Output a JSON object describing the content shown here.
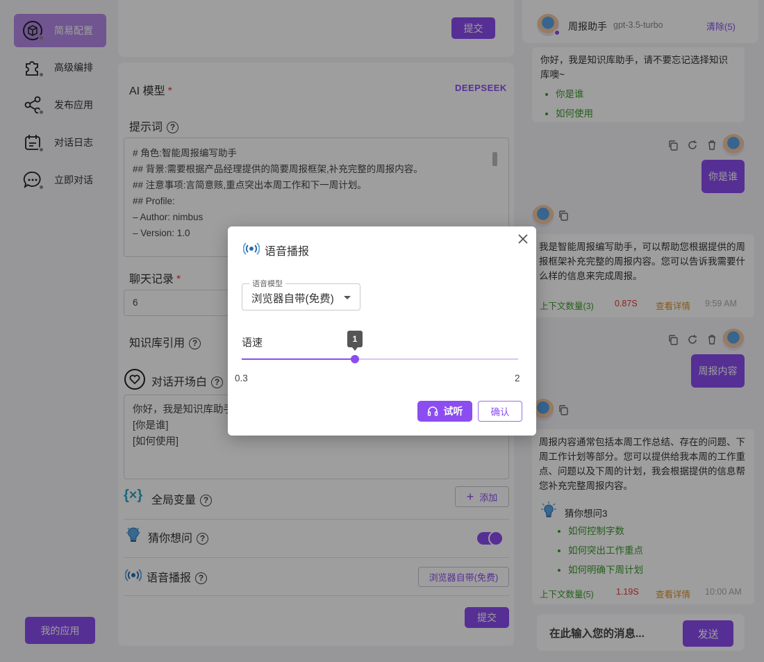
{
  "sidebar": {
    "items": [
      {
        "label": "简易配置",
        "icon": "box-icon"
      },
      {
        "label": "高级编排",
        "icon": "puzzle-icon"
      },
      {
        "label": "发布应用",
        "icon": "share-icon"
      },
      {
        "label": "对话日志",
        "icon": "calendar-icon"
      },
      {
        "label": "立即对话",
        "icon": "chat-icon"
      }
    ],
    "my_apps": "我的应用"
  },
  "config": {
    "submit_top": "提交",
    "ai_model_label": "AI 模型",
    "ai_model_value": "DEEPSEEK",
    "prompt_label": "提示词",
    "prompt_lines": [
      "# 角色:智能周报编写助手",
      "## 背景:需要根据产品经理提供的简要周报框架,补充完整的周报内容。",
      "## 注意事项:言简意赅,重点突出本周工作和下一周计划。",
      "## Profile:",
      "– Author: nimbus",
      "– Version: 1.0"
    ],
    "history_label": "聊天记录",
    "history_value": "6",
    "kb_label": "知识库引用",
    "opening_label": "对话开场白",
    "opening_lines": [
      "你好，我是知识库助手，请不要忘记选择知识库噢~",
      "[你是谁]",
      "[如何使用]"
    ],
    "vars_label": "全局变量",
    "add_label": "添加",
    "guess_label": "猜你想问",
    "tts_label": "语音播报",
    "tts_value": "浏览器自带(免费)",
    "submit_bottom": "提交"
  },
  "chat": {
    "title": "周报助手",
    "model": "gpt-3.5-turbo",
    "clear": "清除(5)",
    "welcome": "你好，我是知识库助手，请不要忘记选择知识库噢~",
    "welcome_options": [
      "你是谁",
      "如何使用"
    ],
    "user_msg_1": "你是谁",
    "ai_msg_1": "我是智能周报编写助手，可以帮助您根据提供的周报框架补充完整的周报内容。您可以告诉我需要什么样的信息来完成周报。",
    "meta_1": {
      "context": "上下文数量(3)",
      "time": "0.87S",
      "detail": "查看详情",
      "clock": "9:59 AM"
    },
    "user_msg_2": "周报内容",
    "ai_msg_2": "周报内容通常包括本周工作总结、存在的问题、下周工作计划等部分。您可以提供给我本周的工作重点、问题以及下周的计划，我会根据提供的信息帮您补充完整周报内容。",
    "guess_title": "猜你想问3",
    "guess_items": [
      "如何控制字数",
      "如何突出工作重点",
      "如何明确下周计划"
    ],
    "meta_2": {
      "context": "上下文数量(5)",
      "time": "1.19S",
      "detail": "查看详情",
      "clock": "10:00 AM"
    },
    "input_placeholder": "在此输入您的消息...",
    "send": "发送"
  },
  "modal": {
    "title": "语音播报",
    "model_legend": "语音模型",
    "model_value": "浏览器自带(免费)",
    "speed_label": "语速",
    "speed_min": "0.3",
    "speed_max": "2",
    "speed_value": "1",
    "speed_fraction": 0.41,
    "listen": "试听",
    "confirm": "确认"
  },
  "colors": {
    "primary": "#8b4df0",
    "green": "#3a9c2b",
    "red": "#e53935",
    "orange": "#e0902a"
  }
}
